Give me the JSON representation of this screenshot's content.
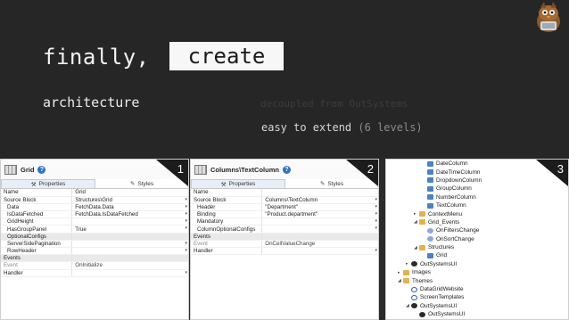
{
  "slide": {
    "headline_prefix": "finally,",
    "headline_box": "create",
    "subtitle": "architecture",
    "faded_note": "decoupled from OutSystems",
    "extend_main": "easy to extend",
    "extend_detail": "(6 levels)"
  },
  "panel1": {
    "badge": "1",
    "title": "Grid",
    "help": "?",
    "tabs": [
      "Properties",
      "Styles"
    ],
    "rows": [
      {
        "k": "Name",
        "v": "Grid",
        "indent": false,
        "type": "row"
      },
      {
        "k": "Source Block",
        "v": "Structures\\Grid",
        "indent": false,
        "type": "row",
        "dd": true
      },
      {
        "k": "Data",
        "v": "FetchData.Data",
        "indent": true,
        "type": "row",
        "dd": true
      },
      {
        "k": "IsDataFetched",
        "v": "FetchData.IsDataFetched",
        "indent": true,
        "type": "row",
        "dd": true
      },
      {
        "k": "GridHeight",
        "v": "",
        "indent": true,
        "type": "row",
        "dd": true
      },
      {
        "k": "HasGroupPanel",
        "v": "True",
        "indent": true,
        "type": "row",
        "dd": true
      },
      {
        "k": "OptionalConfigs",
        "v": "",
        "indent": true,
        "type": "row-gray"
      },
      {
        "k": "ServerSidePagination",
        "v": "",
        "indent": true,
        "type": "row",
        "dd": true
      },
      {
        "k": "RowHeader",
        "v": "",
        "indent": true,
        "type": "row",
        "dd": true
      },
      {
        "k": "Events",
        "v": "",
        "indent": false,
        "type": "sect"
      },
      {
        "k": "Event",
        "v": "OnInitialize",
        "indent": false,
        "type": "dim"
      },
      {
        "k": "Handler",
        "v": "",
        "indent": false,
        "type": "row",
        "dd": true
      }
    ]
  },
  "panel2": {
    "badge": "2",
    "title": "Columns\\TextColumn",
    "help": "?",
    "tabs": [
      "Properties",
      "Styles"
    ],
    "rows": [
      {
        "k": "Name",
        "v": "",
        "indent": false,
        "type": "row"
      },
      {
        "k": "Source Block",
        "v": "Columns\\TextColumn",
        "indent": false,
        "type": "row",
        "dd": true
      },
      {
        "k": "Header",
        "v": "\"Department\"",
        "indent": true,
        "type": "row",
        "dd": true
      },
      {
        "k": "Binding",
        "v": "\"Product.department\"",
        "indent": true,
        "type": "row",
        "dd": true
      },
      {
        "k": "Mandatory",
        "v": "",
        "indent": true,
        "type": "row",
        "dd": true
      },
      {
        "k": "ColumnOptionalConfigs",
        "v": "",
        "indent": true,
        "type": "row",
        "dd": true
      },
      {
        "k": "Events",
        "v": "",
        "indent": false,
        "type": "sect"
      },
      {
        "k": "Event",
        "v": "OnCellValueChange",
        "indent": false,
        "type": "dim"
      },
      {
        "k": "Handler",
        "v": "",
        "indent": false,
        "type": "row",
        "dd": true
      }
    ]
  },
  "panel3": {
    "badge": "3",
    "tree": [
      {
        "label": "DateColumn",
        "level": 4,
        "icon": "blue",
        "tri": ""
      },
      {
        "label": "DateTimeColumn",
        "level": 4,
        "icon": "blue",
        "tri": ""
      },
      {
        "label": "DropdownColumn",
        "level": 4,
        "icon": "blue",
        "tri": ""
      },
      {
        "label": "GroupColumn",
        "level": 4,
        "icon": "blue",
        "tri": ""
      },
      {
        "label": "NumberColumn",
        "level": 4,
        "icon": "blue",
        "tri": ""
      },
      {
        "label": "TextColumn",
        "level": 4,
        "icon": "blue",
        "tri": ""
      },
      {
        "label": "ContextMenu",
        "level": 3,
        "icon": "folder",
        "tri": "▸"
      },
      {
        "label": "Grid_Events",
        "level": 3,
        "icon": "folder",
        "tri": "◢"
      },
      {
        "label": "OnFiltersChange",
        "level": 4,
        "icon": "ev",
        "tri": ""
      },
      {
        "label": "OnSortChange",
        "level": 4,
        "icon": "ev",
        "tri": ""
      },
      {
        "label": "Structures",
        "level": 3,
        "icon": "folder",
        "tri": "◢"
      },
      {
        "label": "Grid",
        "level": 4,
        "icon": "blue",
        "tri": ""
      },
      {
        "label": "OutSystemsUI",
        "level": 2,
        "icon": "blk",
        "tri": "▸"
      },
      {
        "label": "Images",
        "level": 1,
        "icon": "folder",
        "tri": "▸"
      },
      {
        "label": "Themes",
        "level": 1,
        "icon": "folder",
        "tri": "◢"
      },
      {
        "label": "DataGridWebsite",
        "level": 2,
        "icon": "theme",
        "tri": ""
      },
      {
        "label": "ScreenTemplates",
        "level": 2,
        "icon": "theme",
        "tri": ""
      },
      {
        "label": "OutSystemsUI",
        "level": 2,
        "icon": "blk",
        "tri": "◢"
      },
      {
        "label": "OutSystemsUI",
        "level": 3,
        "icon": "blk",
        "tri": ""
      }
    ]
  },
  "colors": {
    "slide_bg": "#262626",
    "box_bg": "#f7f7f7",
    "help_blue": "#2f74c0"
  }
}
